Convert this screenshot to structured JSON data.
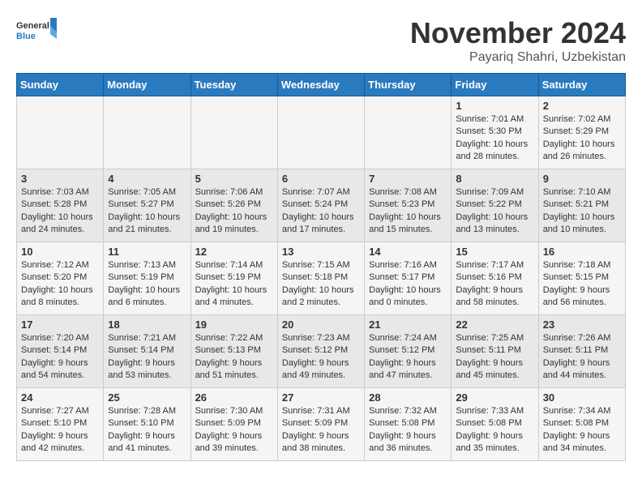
{
  "header": {
    "logo_general": "General",
    "logo_blue": "Blue",
    "month_title": "November 2024",
    "location": "Payariq Shahri, Uzbekistan"
  },
  "weekdays": [
    "Sunday",
    "Monday",
    "Tuesday",
    "Wednesday",
    "Thursday",
    "Friday",
    "Saturday"
  ],
  "weeks": [
    [
      {
        "day": "",
        "sunrise": "",
        "sunset": "",
        "daylight": ""
      },
      {
        "day": "",
        "sunrise": "",
        "sunset": "",
        "daylight": ""
      },
      {
        "day": "",
        "sunrise": "",
        "sunset": "",
        "daylight": ""
      },
      {
        "day": "",
        "sunrise": "",
        "sunset": "",
        "daylight": ""
      },
      {
        "day": "",
        "sunrise": "",
        "sunset": "",
        "daylight": ""
      },
      {
        "day": "1",
        "sunrise": "Sunrise: 7:01 AM",
        "sunset": "Sunset: 5:30 PM",
        "daylight": "Daylight: 10 hours and 28 minutes."
      },
      {
        "day": "2",
        "sunrise": "Sunrise: 7:02 AM",
        "sunset": "Sunset: 5:29 PM",
        "daylight": "Daylight: 10 hours and 26 minutes."
      }
    ],
    [
      {
        "day": "3",
        "sunrise": "Sunrise: 7:03 AM",
        "sunset": "Sunset: 5:28 PM",
        "daylight": "Daylight: 10 hours and 24 minutes."
      },
      {
        "day": "4",
        "sunrise": "Sunrise: 7:05 AM",
        "sunset": "Sunset: 5:27 PM",
        "daylight": "Daylight: 10 hours and 21 minutes."
      },
      {
        "day": "5",
        "sunrise": "Sunrise: 7:06 AM",
        "sunset": "Sunset: 5:26 PM",
        "daylight": "Daylight: 10 hours and 19 minutes."
      },
      {
        "day": "6",
        "sunrise": "Sunrise: 7:07 AM",
        "sunset": "Sunset: 5:24 PM",
        "daylight": "Daylight: 10 hours and 17 minutes."
      },
      {
        "day": "7",
        "sunrise": "Sunrise: 7:08 AM",
        "sunset": "Sunset: 5:23 PM",
        "daylight": "Daylight: 10 hours and 15 minutes."
      },
      {
        "day": "8",
        "sunrise": "Sunrise: 7:09 AM",
        "sunset": "Sunset: 5:22 PM",
        "daylight": "Daylight: 10 hours and 13 minutes."
      },
      {
        "day": "9",
        "sunrise": "Sunrise: 7:10 AM",
        "sunset": "Sunset: 5:21 PM",
        "daylight": "Daylight: 10 hours and 10 minutes."
      }
    ],
    [
      {
        "day": "10",
        "sunrise": "Sunrise: 7:12 AM",
        "sunset": "Sunset: 5:20 PM",
        "daylight": "Daylight: 10 hours and 8 minutes."
      },
      {
        "day": "11",
        "sunrise": "Sunrise: 7:13 AM",
        "sunset": "Sunset: 5:19 PM",
        "daylight": "Daylight: 10 hours and 6 minutes."
      },
      {
        "day": "12",
        "sunrise": "Sunrise: 7:14 AM",
        "sunset": "Sunset: 5:19 PM",
        "daylight": "Daylight: 10 hours and 4 minutes."
      },
      {
        "day": "13",
        "sunrise": "Sunrise: 7:15 AM",
        "sunset": "Sunset: 5:18 PM",
        "daylight": "Daylight: 10 hours and 2 minutes."
      },
      {
        "day": "14",
        "sunrise": "Sunrise: 7:16 AM",
        "sunset": "Sunset: 5:17 PM",
        "daylight": "Daylight: 10 hours and 0 minutes."
      },
      {
        "day": "15",
        "sunrise": "Sunrise: 7:17 AM",
        "sunset": "Sunset: 5:16 PM",
        "daylight": "Daylight: 9 hours and 58 minutes."
      },
      {
        "day": "16",
        "sunrise": "Sunrise: 7:18 AM",
        "sunset": "Sunset: 5:15 PM",
        "daylight": "Daylight: 9 hours and 56 minutes."
      }
    ],
    [
      {
        "day": "17",
        "sunrise": "Sunrise: 7:20 AM",
        "sunset": "Sunset: 5:14 PM",
        "daylight": "Daylight: 9 hours and 54 minutes."
      },
      {
        "day": "18",
        "sunrise": "Sunrise: 7:21 AM",
        "sunset": "Sunset: 5:14 PM",
        "daylight": "Daylight: 9 hours and 53 minutes."
      },
      {
        "day": "19",
        "sunrise": "Sunrise: 7:22 AM",
        "sunset": "Sunset: 5:13 PM",
        "daylight": "Daylight: 9 hours and 51 minutes."
      },
      {
        "day": "20",
        "sunrise": "Sunrise: 7:23 AM",
        "sunset": "Sunset: 5:12 PM",
        "daylight": "Daylight: 9 hours and 49 minutes."
      },
      {
        "day": "21",
        "sunrise": "Sunrise: 7:24 AM",
        "sunset": "Sunset: 5:12 PM",
        "daylight": "Daylight: 9 hours and 47 minutes."
      },
      {
        "day": "22",
        "sunrise": "Sunrise: 7:25 AM",
        "sunset": "Sunset: 5:11 PM",
        "daylight": "Daylight: 9 hours and 45 minutes."
      },
      {
        "day": "23",
        "sunrise": "Sunrise: 7:26 AM",
        "sunset": "Sunset: 5:11 PM",
        "daylight": "Daylight: 9 hours and 44 minutes."
      }
    ],
    [
      {
        "day": "24",
        "sunrise": "Sunrise: 7:27 AM",
        "sunset": "Sunset: 5:10 PM",
        "daylight": "Daylight: 9 hours and 42 minutes."
      },
      {
        "day": "25",
        "sunrise": "Sunrise: 7:28 AM",
        "sunset": "Sunset: 5:10 PM",
        "daylight": "Daylight: 9 hours and 41 minutes."
      },
      {
        "day": "26",
        "sunrise": "Sunrise: 7:30 AM",
        "sunset": "Sunset: 5:09 PM",
        "daylight": "Daylight: 9 hours and 39 minutes."
      },
      {
        "day": "27",
        "sunrise": "Sunrise: 7:31 AM",
        "sunset": "Sunset: 5:09 PM",
        "daylight": "Daylight: 9 hours and 38 minutes."
      },
      {
        "day": "28",
        "sunrise": "Sunrise: 7:32 AM",
        "sunset": "Sunset: 5:08 PM",
        "daylight": "Daylight: 9 hours and 36 minutes."
      },
      {
        "day": "29",
        "sunrise": "Sunrise: 7:33 AM",
        "sunset": "Sunset: 5:08 PM",
        "daylight": "Daylight: 9 hours and 35 minutes."
      },
      {
        "day": "30",
        "sunrise": "Sunrise: 7:34 AM",
        "sunset": "Sunset: 5:08 PM",
        "daylight": "Daylight: 9 hours and 34 minutes."
      }
    ]
  ]
}
